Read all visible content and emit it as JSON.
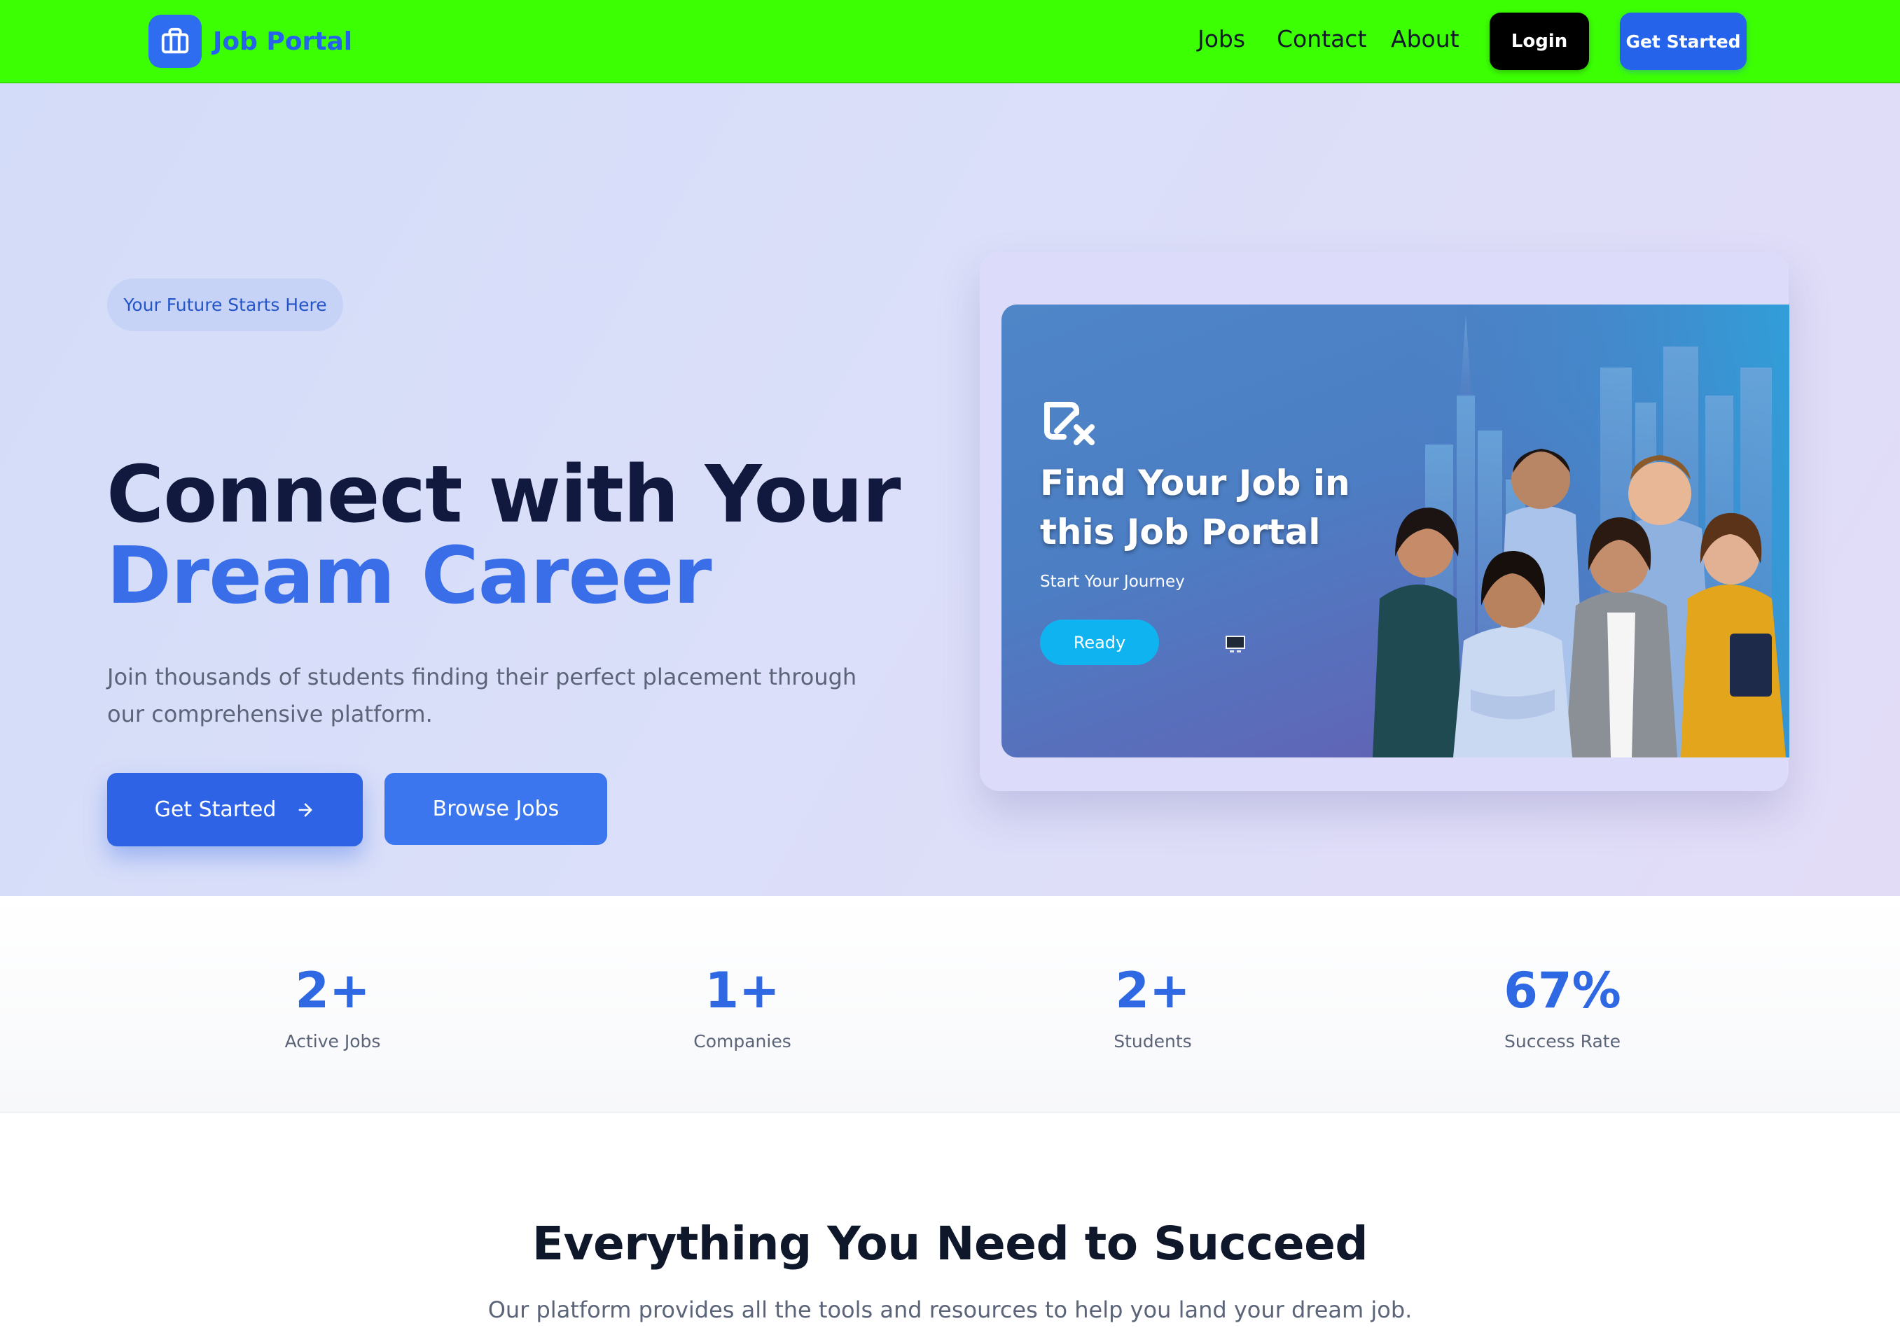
{
  "navbar": {
    "brand_name": "Job Portal",
    "brand_icon": "briefcase-icon",
    "links": [
      "Jobs",
      "Contact",
      "About"
    ],
    "login_label": "Login",
    "get_started_label": "Get Started",
    "background_color": "#3cff04"
  },
  "hero": {
    "badge": "Your Future Starts Here",
    "title_line1": "Connect with Your",
    "title_line2": "Dream Career",
    "subtitle": "Join thousands of students finding their perfect placement through our comprehensive platform.",
    "primary_button": "Get Started",
    "primary_button_icon": "arrow-right-icon",
    "secondary_button": "Browse Jobs",
    "banner": {
      "title": "Find Your Job in this Job Portal",
      "subtitle": "Start Your Journey",
      "button": "Ready",
      "logo_icon": "portal-logo-icon",
      "monitor_icon": "monitor-icon"
    }
  },
  "stats": [
    {
      "value": "2+",
      "label": "Active Jobs"
    },
    {
      "value": "1+",
      "label": "Companies"
    },
    {
      "value": "2+",
      "label": "Students"
    },
    {
      "value": "67%",
      "label": "Success Rate"
    }
  ],
  "features": {
    "title": "Everything You Need to Succeed",
    "subtitle": "Our platform provides all the tools and resources to help you land your dream job."
  },
  "colors": {
    "accent": "#2563eb",
    "title_dark": "#111a3e",
    "title_accent": "#3a6ee8"
  }
}
